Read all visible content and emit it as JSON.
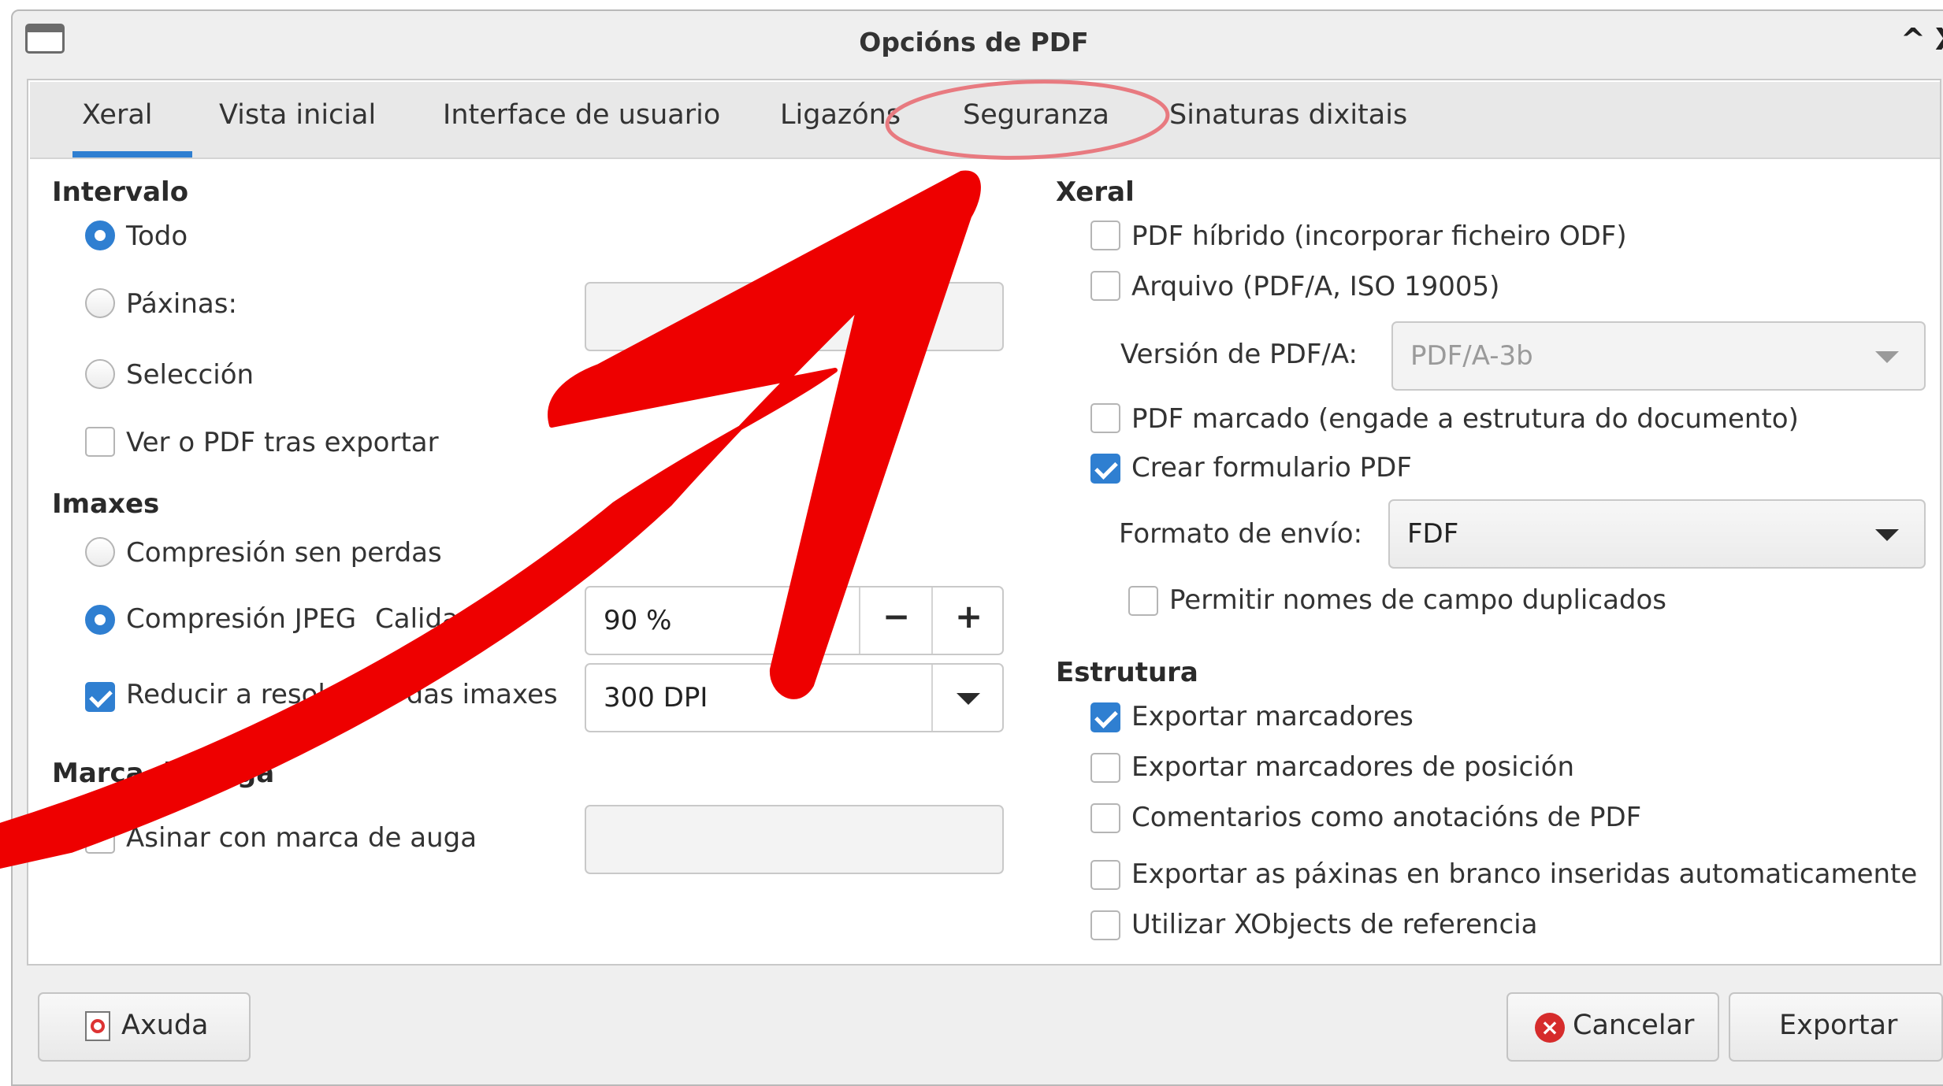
{
  "window": {
    "title": "Opcións de PDF",
    "maximize_glyph": "^",
    "close_glyph": "X"
  },
  "tabs": [
    {
      "label": "Xeral"
    },
    {
      "label": "Vista inicial"
    },
    {
      "label": "Interface de usuario"
    },
    {
      "label": "Ligazóns"
    },
    {
      "label": "Seguranza"
    },
    {
      "label": "Sinaturas dixitais"
    }
  ],
  "left": {
    "range": {
      "header": "Intervalo",
      "all": "Todo",
      "pages": "Páxinas:",
      "selection": "Selección",
      "view_after_export": "Ver o PDF tras exportar"
    },
    "images": {
      "header": "Imaxes",
      "lossless": "Compresión sen perdas",
      "jpeg": "Compresión JPEG",
      "quality_label": "Calidade:",
      "quality_value": "90  %",
      "reduce": "Reducir a resolución das imaxes",
      "resolution_value": "300 DPI",
      "minus": "−",
      "plus": "+"
    },
    "watermark": {
      "header": "Marca de auga",
      "sign": "Asinar con marca de auga"
    }
  },
  "right": {
    "general": {
      "header": "Xeral",
      "hybrid": "PDF híbrido (incorporar ficheiro ODF)",
      "archive": "Arquivo (PDF/A, ISO 19005)",
      "pdfa_version_label": "Versión de PDF/A:",
      "pdfa_version_value": "PDF/A-3b",
      "tagged": "PDF marcado (engade a estrutura do documento)",
      "create_form": "Crear formulario PDF",
      "submit_format_label": "Formato de envío:",
      "submit_format_value": "FDF",
      "allow_duplicate": "Permitir nomes de campo duplicados"
    },
    "structure": {
      "header": "Estrutura",
      "export_bookmarks": "Exportar marcadores",
      "export_placeholders": "Exportar marcadores de posición",
      "comments": "Comentarios como anotacións de PDF",
      "blank_pages": "Exportar as páxinas en branco inseridas automaticamente",
      "xobjects": "Utilizar XObjects de referencia"
    }
  },
  "footer": {
    "help": "Axuda",
    "cancel": "Cancelar",
    "export": "Exportar"
  },
  "colors": {
    "accent": "#2f7fd1",
    "annotation_arrow": "#ee0000",
    "annotation_circle": "#e87a80"
  }
}
